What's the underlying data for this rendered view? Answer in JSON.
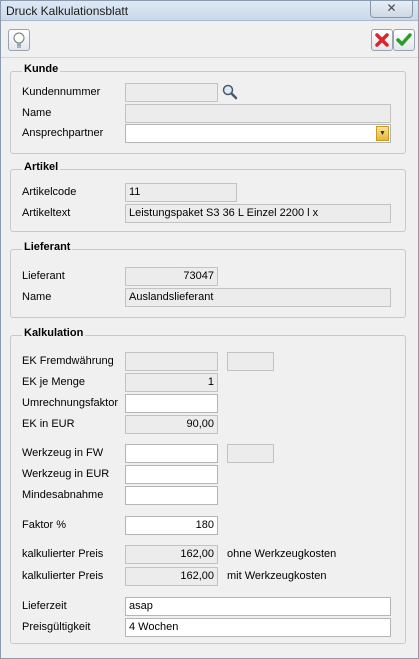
{
  "window": {
    "title": "Druck Kalkulationsblatt"
  },
  "toolbar": {
    "bulb_icon": "lightbulb-icon",
    "cancel_icon": "red-x-icon",
    "ok_icon": "green-check-icon"
  },
  "kunde": {
    "title": "Kunde",
    "kundennummer_label": "Kundennummer",
    "kundennummer_value": "",
    "name_label": "Name",
    "name_value": "",
    "ansprechpartner_label": "Ansprechpartner",
    "ansprechpartner_value": ""
  },
  "artikel": {
    "title": "Artikel",
    "artikelcode_label": "Artikelcode",
    "artikelcode_value": "11",
    "artikeltext_label": "Artikeltext",
    "artikeltext_value": "Leistungspaket S3 36 L Einzel 2200 l x"
  },
  "lieferant": {
    "title": "Lieferant",
    "lieferant_label": "Lieferant",
    "lieferant_value": "73047",
    "name_label": "Name",
    "name_value": "Auslandslieferant"
  },
  "kalkulation": {
    "title": "Kalkulation",
    "ek_fremd_label": "EK Fremdwährung",
    "ek_fremd_value": "",
    "ek_fremd_currency": "",
    "ek_menge_label": "EK je Menge",
    "ek_menge_value": "1",
    "umrechnung_label": "Umrechnungsfaktor",
    "umrechnung_value": "",
    "ek_eur_label": "EK in EUR",
    "ek_eur_value": "90,00",
    "wz_fw_label": "Werkzeug in FW",
    "wz_fw_value": "",
    "wz_fw_currency": "",
    "wz_eur_label": "Werkzeug in EUR",
    "wz_eur_value": "",
    "mindest_label": "Mindesabnahme",
    "mindest_value": "",
    "faktor_label": "Faktor %",
    "faktor_value": "180",
    "preis1_label": "kalkulierter Preis",
    "preis1_value": "162,00",
    "preis1_note": "ohne Werkzeugkosten",
    "preis2_label": "kalkulierter Preis",
    "preis2_value": "162,00",
    "preis2_note": "mit Werkzeugkosten",
    "lieferzeit_label": "Lieferzeit",
    "lieferzeit_value": "asap",
    "preisgueltig_label": "Preisgültigkeit",
    "preisgueltig_value": "4 Wochen"
  }
}
